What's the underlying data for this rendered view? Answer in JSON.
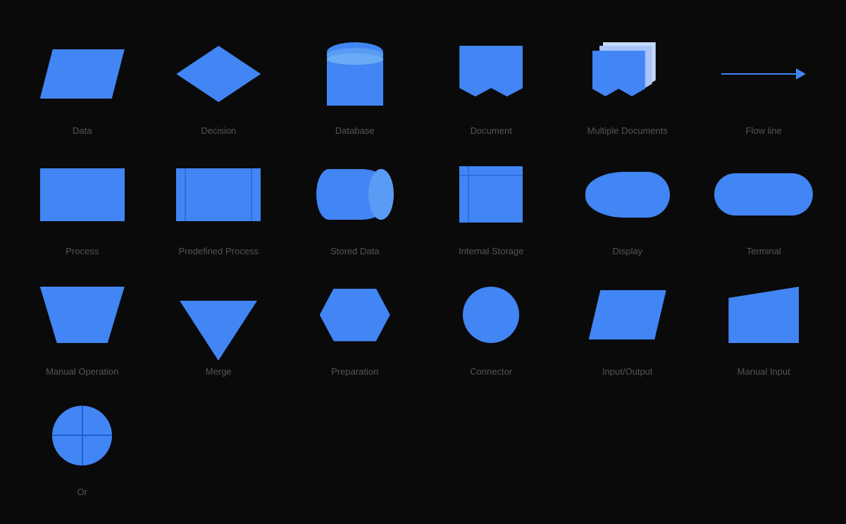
{
  "shapes": {
    "row1": [
      {
        "id": "data",
        "label": "Data"
      },
      {
        "id": "decision",
        "label": "Decision"
      },
      {
        "id": "database",
        "label": "Database"
      },
      {
        "id": "document",
        "label": "Document"
      },
      {
        "id": "multiple-documents",
        "label": "Multiple Documents"
      },
      {
        "id": "flow-line",
        "label": "Flow line"
      }
    ],
    "row2": [
      {
        "id": "process",
        "label": "Process"
      },
      {
        "id": "predefined-process",
        "label": "Predefined Process"
      },
      {
        "id": "stored-data",
        "label": "Stored Data"
      },
      {
        "id": "internal-storage",
        "label": "Internal Storage"
      },
      {
        "id": "display",
        "label": "Display"
      },
      {
        "id": "terminal",
        "label": "Terminal"
      }
    ],
    "row3": [
      {
        "id": "manual-operation",
        "label": "Manual Operation"
      },
      {
        "id": "merge",
        "label": "Merge"
      },
      {
        "id": "preparation",
        "label": "Preparation"
      },
      {
        "id": "connector",
        "label": "Connector"
      },
      {
        "id": "input-output",
        "label": "Input/Output"
      },
      {
        "id": "manual-input",
        "label": "Manual Input"
      },
      {
        "id": "or",
        "label": "Or"
      }
    ]
  }
}
